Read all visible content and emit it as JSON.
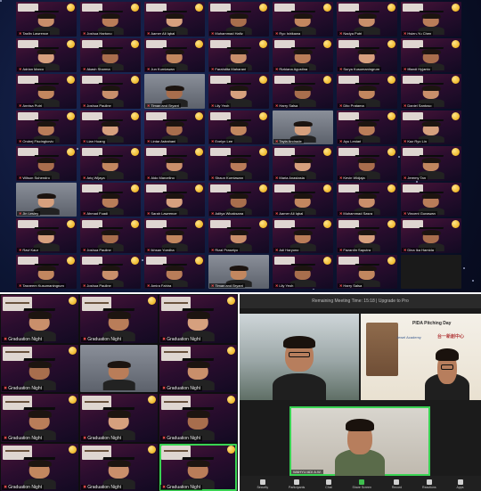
{
  "top_gallery": {
    "tiles": [
      {
        "name": "Tasfin Lawrence",
        "type": "grad"
      },
      {
        "name": "Joshua Hartono",
        "type": "grad"
      },
      {
        "name": "Aamer Ali Iqbal",
        "type": "grad"
      },
      {
        "name": "Muhammad Hafiz",
        "type": "grad"
      },
      {
        "name": "Ryo Ishikawa",
        "type": "grad"
      },
      {
        "name": "Nadya Putri",
        "type": "grad"
      },
      {
        "name": "Hsien-Yu Chen",
        "type": "grad"
      },
      {
        "name": "Adrian Marco",
        "type": "grad"
      },
      {
        "name": "Akash Sharma",
        "type": "grad"
      },
      {
        "name": "Jun Kurniawan",
        "type": "grad"
      },
      {
        "name": "Farahdita Maharani",
        "type": "grad"
      },
      {
        "name": "Rizkiana Agustina",
        "type": "grad"
      },
      {
        "name": "Surya Kusumaningrum",
        "type": "grad"
      },
      {
        "name": "Iffandi Hyjanto",
        "type": "grad"
      },
      {
        "name": "Annisa Putri",
        "type": "grad"
      },
      {
        "name": "Joshua Pauline",
        "type": "grad"
      },
      {
        "name": "Timan and Bryant",
        "type": "camera"
      },
      {
        "name": "Lily Yeoh",
        "type": "grad"
      },
      {
        "name": "Harry Salsa",
        "type": "grad"
      },
      {
        "name": "Dito Pratama",
        "type": "grad"
      },
      {
        "name": "Daniel Santoso",
        "type": "grad"
      },
      {
        "name": "Ondrej Fiscingkovic",
        "type": "grad"
      },
      {
        "name": "Lian Huang",
        "type": "grad"
      },
      {
        "name": "Lintar Astrahani",
        "type": "grad"
      },
      {
        "name": "Evelyn Lee",
        "type": "grad"
      },
      {
        "name": "Tayla Andrade",
        "type": "camera"
      },
      {
        "name": "Ayu Lestari",
        "type": "grad"
      },
      {
        "name": "Kaz Ryo Lin",
        "type": "grad"
      },
      {
        "name": "Wilson Suhendro",
        "type": "grad"
      },
      {
        "name": "Ariq Wijaya",
        "type": "grad"
      },
      {
        "name": "Aldo Marcelino",
        "type": "grad"
      },
      {
        "name": "Shaun Kurniawan",
        "type": "grad"
      },
      {
        "name": "Maria Anastasia",
        "type": "grad"
      },
      {
        "name": "Kevin Widjaja",
        "type": "grad"
      },
      {
        "name": "Jeremy Tan",
        "type": "grad"
      },
      {
        "name": "Jin Lesley",
        "type": "camera"
      },
      {
        "name": "Ahmad Fuadi",
        "type": "grad"
      },
      {
        "name": "Sarah Lawrence",
        "type": "grad"
      },
      {
        "name": "Aditya Wicaksana",
        "type": "grad"
      },
      {
        "name": "Aamer Ali Iqbal",
        "type": "grad"
      },
      {
        "name": "Muhammad Sasra",
        "type": "grad"
      },
      {
        "name": "Vincent Gunawan",
        "type": "grad"
      },
      {
        "name": "Ravi Kaur",
        "type": "grad"
      },
      {
        "name": "Joshua Pauline",
        "type": "grad"
      },
      {
        "name": "Ikhsan Yoedha",
        "type": "grad"
      },
      {
        "name": "Rizal Prasetyo",
        "type": "grad"
      },
      {
        "name": "Adi Haryono",
        "type": "grad"
      },
      {
        "name": "Fazardin Saputra",
        "type": "grad"
      },
      {
        "name": "Dina Ika Hamida",
        "type": "grad"
      },
      {
        "name": "Tasneem Kusumaningrum",
        "type": "grad"
      },
      {
        "name": "Joshua Pauline",
        "type": "grad"
      },
      {
        "name": "Amira Fahira",
        "type": "grad"
      },
      {
        "name": "Timan and Bryant",
        "type": "camera"
      },
      {
        "name": "Lily Yeoh",
        "type": "grad"
      },
      {
        "name": "Harry Salsa",
        "type": "grad"
      },
      {
        "name": "",
        "type": "dark"
      }
    ]
  },
  "bottom_left_gallery": {
    "tiles": [
      {
        "name": "Graduation Night",
        "type": "grad"
      },
      {
        "name": "Graduation Night",
        "type": "grad"
      },
      {
        "name": "Graduation Night",
        "type": "grad"
      },
      {
        "name": "Graduation Night",
        "type": "grad"
      },
      {
        "name": "",
        "type": "camera"
      },
      {
        "name": "Graduation Night",
        "type": "grad"
      },
      {
        "name": "Graduation Night",
        "type": "grad"
      },
      {
        "name": "Graduation Night",
        "type": "grad"
      },
      {
        "name": "Graduation Night",
        "type": "grad"
      },
      {
        "name": "Graduation Night",
        "type": "grad"
      },
      {
        "name": "Graduation Night",
        "type": "grad"
      },
      {
        "name": "Graduation Night",
        "type": "grad",
        "active": true
      }
    ]
  },
  "speaker_view": {
    "title_bar": "Remaining Meeting Time: 15:18 | Upgrade to Pro",
    "slide": {
      "title": "PIDA Pitching Day",
      "logo_a": "Jewel Academy",
      "logo_b": "台一新創中心"
    },
    "main_speaker_name": "WAHYU ADI A.W.",
    "toolbar": [
      {
        "label": "Security",
        "icon": "shield-icon",
        "color": "default"
      },
      {
        "label": "Participants",
        "icon": "people-icon",
        "color": "default"
      },
      {
        "label": "Chat",
        "icon": "chat-icon",
        "color": "default"
      },
      {
        "label": "Share Screen",
        "icon": "share-screen-icon",
        "color": "green"
      },
      {
        "label": "Record",
        "icon": "record-icon",
        "color": "default"
      },
      {
        "label": "Reactions",
        "icon": "reactions-icon",
        "color": "default"
      },
      {
        "label": "Apps",
        "icon": "apps-icon",
        "color": "default"
      }
    ]
  }
}
